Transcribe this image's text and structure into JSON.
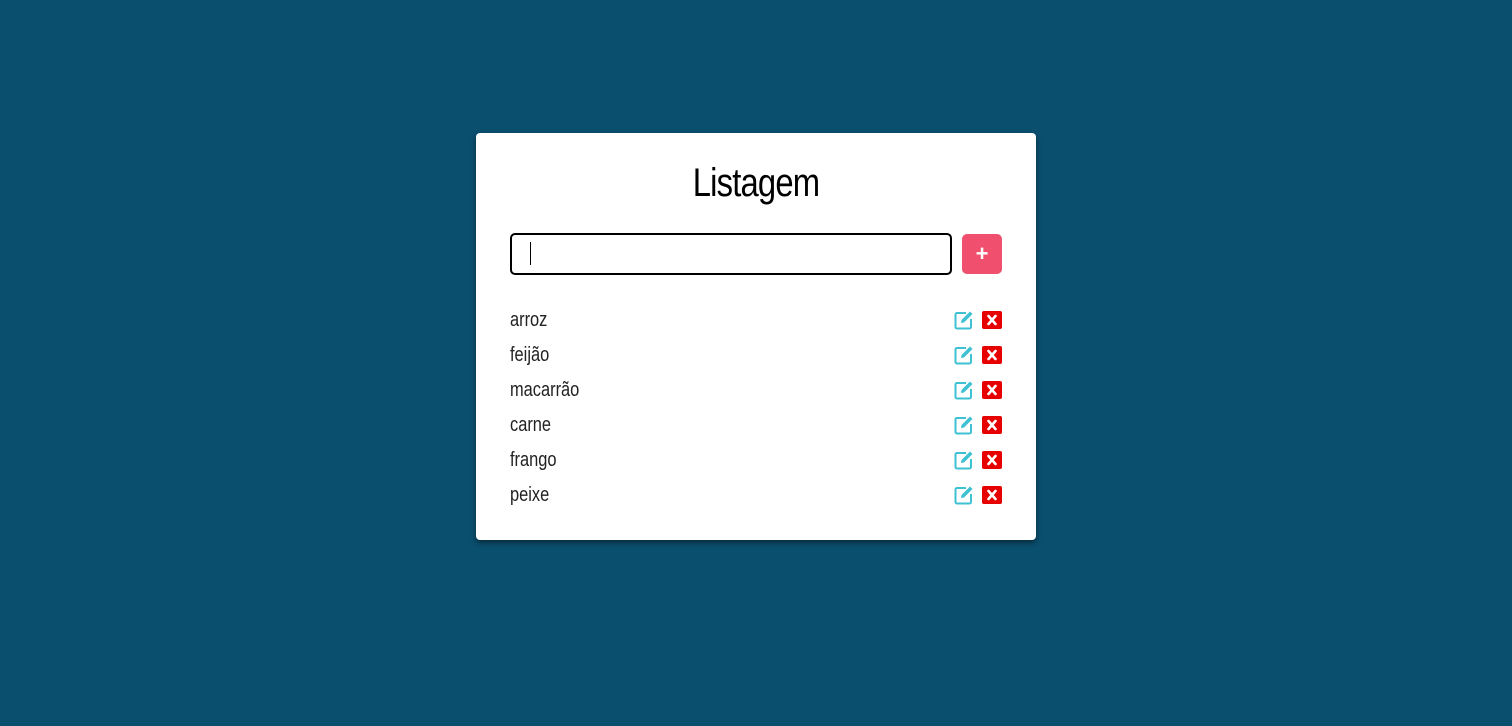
{
  "page": {
    "background_color": "#0b4f6f"
  },
  "card": {
    "title": "Listagem"
  },
  "new_item": {
    "value": "",
    "placeholder": "",
    "add_label": "+",
    "add_color": "#f0506e"
  },
  "items": [
    {
      "label": "arroz",
      "edit_icon": "edit-icon",
      "delete_icon": "close-icon"
    },
    {
      "label": "feijão",
      "edit_icon": "edit-icon",
      "delete_icon": "close-icon"
    },
    {
      "label": "macarrão",
      "edit_icon": "edit-icon",
      "delete_icon": "close-icon"
    },
    {
      "label": "carne",
      "edit_icon": "edit-icon",
      "delete_icon": "close-icon"
    },
    {
      "label": "frango",
      "edit_icon": "edit-icon",
      "delete_icon": "close-icon"
    },
    {
      "label": "peixe",
      "edit_icon": "edit-icon",
      "delete_icon": "close-icon"
    }
  ],
  "colors": {
    "edit": "#3ec1d3",
    "delete": "#e60000"
  }
}
